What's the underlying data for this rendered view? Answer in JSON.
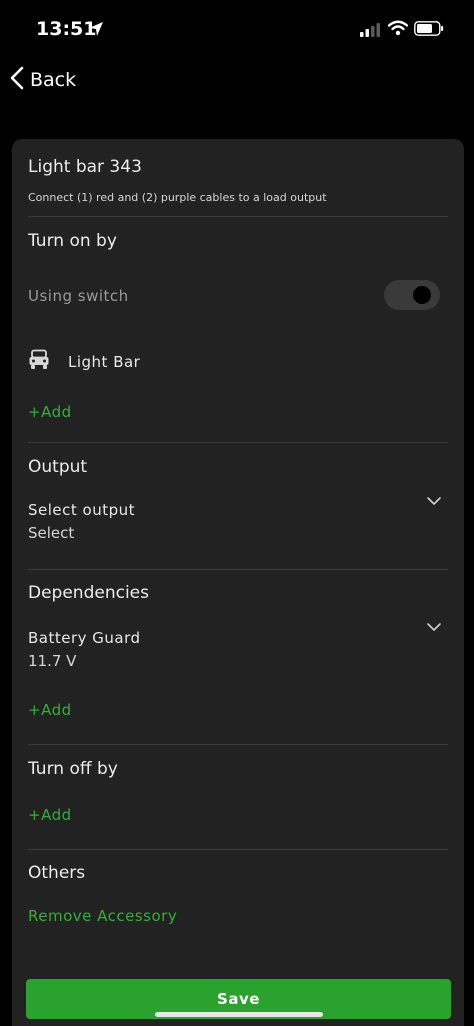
{
  "status_bar": {
    "time": "13:51"
  },
  "nav": {
    "back_label": "Back"
  },
  "accessory": {
    "title": "Light bar 343",
    "subtitle": "Connect (1) red and (2) purple cables to a load output"
  },
  "turn_on": {
    "heading": "Turn on by",
    "switch_label": "Using switch",
    "switch_on": true,
    "trigger_name": "Light Bar",
    "add_label": "+Add"
  },
  "output": {
    "heading": "Output",
    "field_label": "Select output",
    "field_value": "Select"
  },
  "dependencies": {
    "heading": "Dependencies",
    "item_label": "Battery Guard",
    "item_value": "11.7 V",
    "add_label": "+Add"
  },
  "turn_off": {
    "heading": "Turn off by",
    "add_label": "+Add"
  },
  "others": {
    "heading": "Others",
    "remove_label": "Remove Accessory"
  },
  "footer": {
    "save_label": "Save"
  },
  "colors": {
    "accent_green": "#2fb233",
    "save_green": "#2aa22e",
    "card_bg": "#222222",
    "page_bg": "#000000"
  },
  "icons": [
    "location-arrow-icon",
    "signal-icon",
    "wifi-icon",
    "battery-icon",
    "chevron-left-icon",
    "car-icon",
    "chevron-down-icon"
  ]
}
